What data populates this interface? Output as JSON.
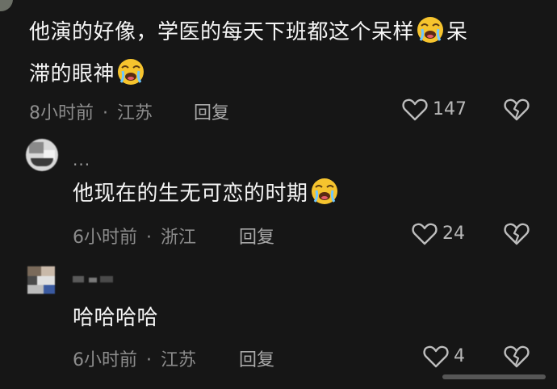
{
  "comments": [
    {
      "text_parts": [
        "他演的好像，学医的每天下班都这个呆样",
        "呆",
        "滞的眼神"
      ],
      "time": "8小时前",
      "location": "江苏",
      "reply_label": "回复",
      "likes": "147"
    },
    {
      "username": "...",
      "text": "他现在的生无可恋的时期",
      "time": "6小时前",
      "location": "浙江",
      "reply_label": "回复",
      "likes": "24"
    },
    {
      "text": "哈哈哈哈",
      "time": "6小时前",
      "location": "江苏",
      "reply_label": "回复",
      "likes": "4"
    }
  ],
  "separator": "·",
  "colors": {
    "background": "#161616",
    "text": "#f4f4f4",
    "meta": "#8c8c8c",
    "emoji": "#f6c42e"
  },
  "icons": {
    "emoji": "crying-laughing-emoji-icon",
    "like": "heart-outline-icon",
    "dislike": "broken-heart-icon"
  }
}
